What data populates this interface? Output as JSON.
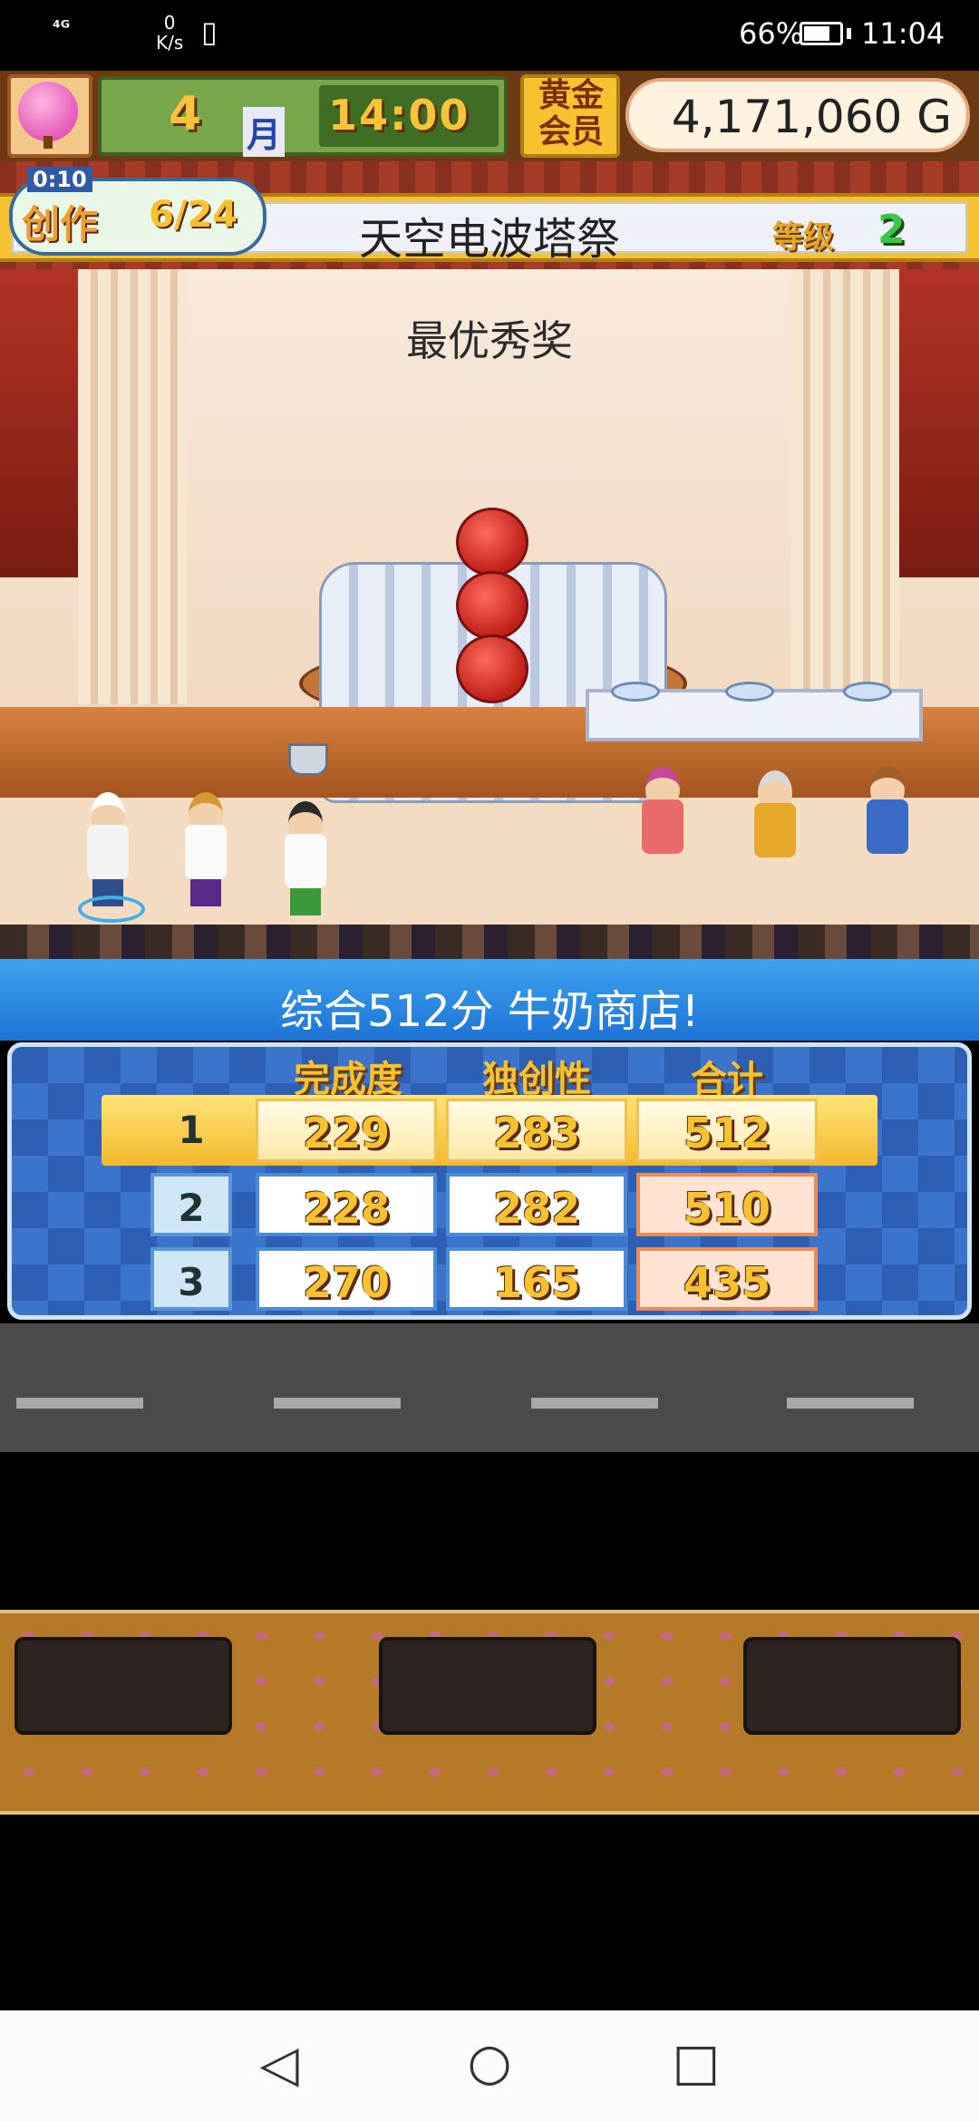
{
  "status_bar": {
    "network": "⁴ᴳ",
    "speed_value": "0",
    "speed_unit": "K/s",
    "battery_pct": "66%",
    "time": "11:04"
  },
  "game_header": {
    "month_number": "4",
    "month_label": "月",
    "clock": "14:00",
    "gold_member_badge": "黄金会员",
    "money": "4,171,060 G"
  },
  "creation": {
    "timer": "0:10",
    "label": "创作",
    "progress": "6/24"
  },
  "event": {
    "name": "天空电波塔祭",
    "rank_label": "等级",
    "rank_value": "2"
  },
  "award": {
    "title": "最优秀奖"
  },
  "result": {
    "summary": "综合512分 牛奶商店!",
    "columns": [
      "完成度",
      "独创性",
      "合计"
    ],
    "rows": [
      {
        "rank": "1",
        "completion": "229",
        "originality": "283",
        "total": "512"
      },
      {
        "rank": "2",
        "completion": "228",
        "originality": "282",
        "total": "510"
      },
      {
        "rank": "3",
        "completion": "270",
        "originality": "165",
        "total": "435"
      }
    ]
  },
  "nav_bar": {
    "back": "◁",
    "home": "○",
    "recent": "□"
  }
}
